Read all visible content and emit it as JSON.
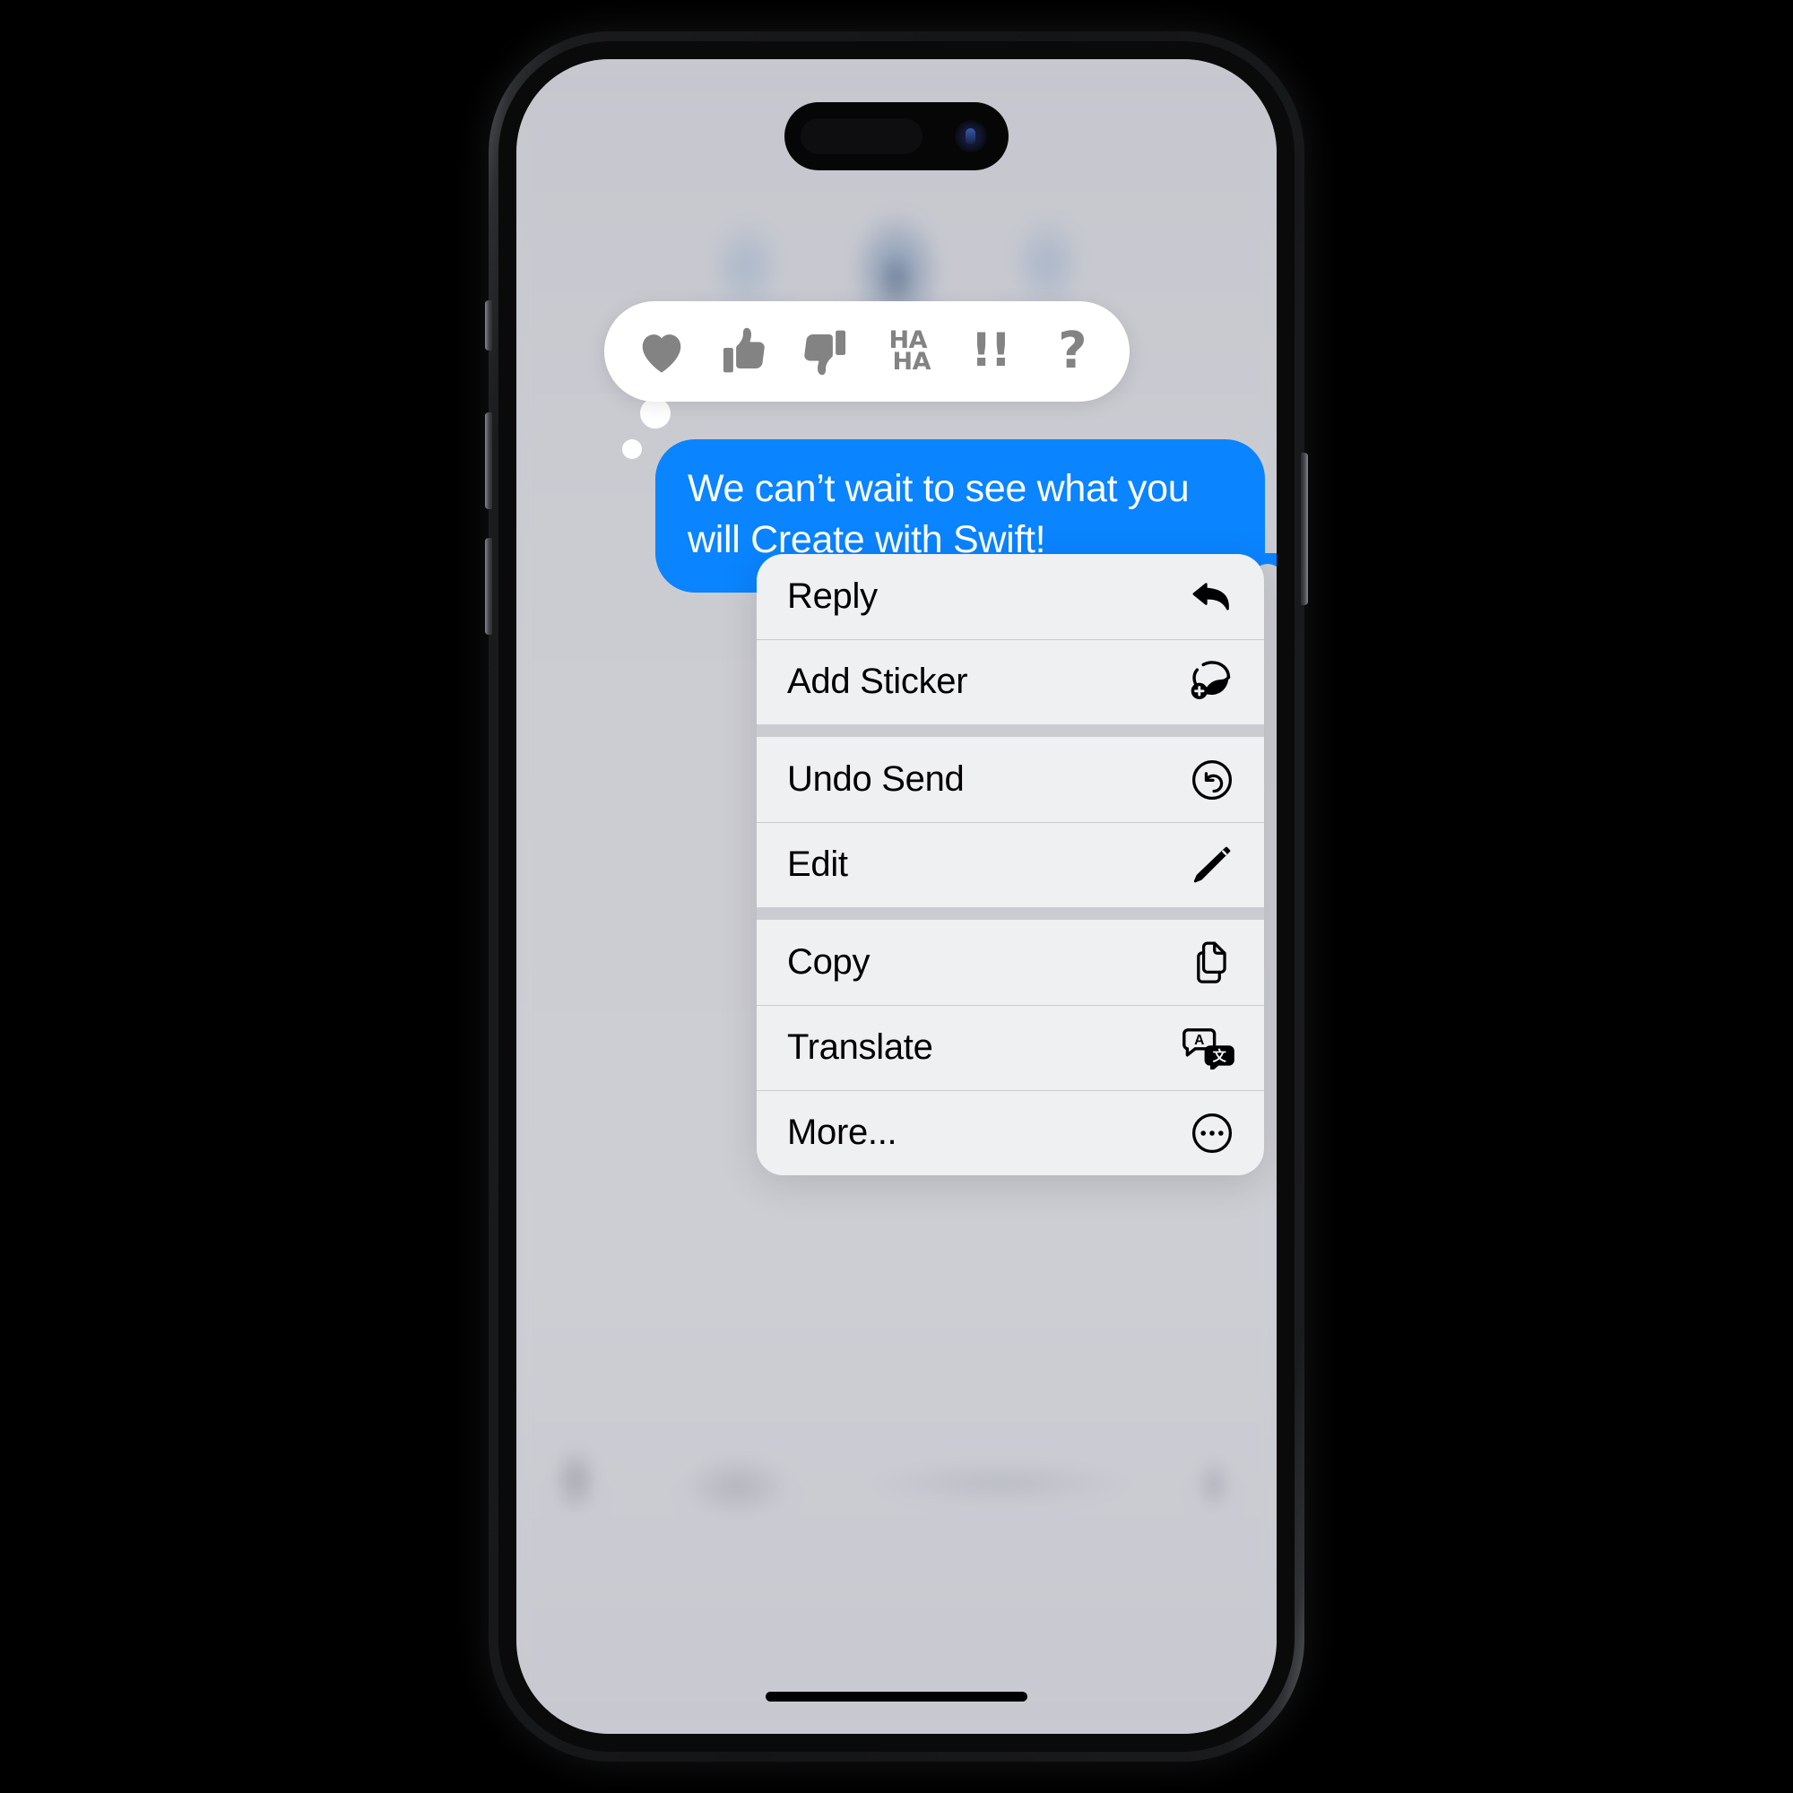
{
  "device": {
    "name": "iPhone",
    "dynamic_island": "dynamic-island",
    "camera": "front-camera-lens",
    "home_indicator": "home-indicator",
    "buttons": [
      {
        "name": "silent-switch",
        "side": "left"
      },
      {
        "name": "volume-up-button",
        "side": "left"
      },
      {
        "name": "volume-down-button",
        "side": "left"
      },
      {
        "name": "power-button",
        "side": "right"
      }
    ]
  },
  "colors": {
    "bubble_blue": "#0A84FF",
    "menu_background": "#EFF0F2",
    "tapback_background": "#FFFFFF",
    "tapback_glyph": "#838383",
    "menu_text": "#000000",
    "screen_background": "#CBCCD2",
    "frame": "#141517"
  },
  "tapback_bar": {
    "name": "tapback-reaction-bar",
    "options": [
      {
        "id": "heart",
        "icon": "heart-icon",
        "label": "Love"
      },
      {
        "id": "thumbsup",
        "icon": "thumbs-up-icon",
        "label": "Like"
      },
      {
        "id": "thumbsdown",
        "icon": "thumbs-down-icon",
        "label": "Dislike"
      },
      {
        "id": "haha",
        "icon": "haha-text-icon",
        "label": "HA",
        "label2": "HA"
      },
      {
        "id": "exclaim",
        "icon": "exclamation-icon",
        "label": "!!"
      },
      {
        "id": "question",
        "icon": "question-mark-icon",
        "label": "?"
      }
    ]
  },
  "message": {
    "name": "outgoing-message-bubble",
    "text": "We can’t wait to see what you will Create with Swift!",
    "direction": "outgoing"
  },
  "context_menu": {
    "name": "message-context-menu",
    "groups": [
      {
        "items": [
          {
            "label": "Reply",
            "icon": "reply-arrow-icon"
          },
          {
            "label": "Add Sticker",
            "icon": "add-sticker-icon"
          }
        ]
      },
      {
        "items": [
          {
            "label": "Undo Send",
            "icon": "undo-send-icon"
          },
          {
            "label": "Edit",
            "icon": "pencil-icon"
          }
        ]
      },
      {
        "items": [
          {
            "label": "Copy",
            "icon": "copy-documents-icon"
          },
          {
            "label": "Translate",
            "icon": "translate-icon"
          },
          {
            "label": "More...",
            "icon": "ellipsis-circle-icon"
          }
        ]
      }
    ]
  }
}
